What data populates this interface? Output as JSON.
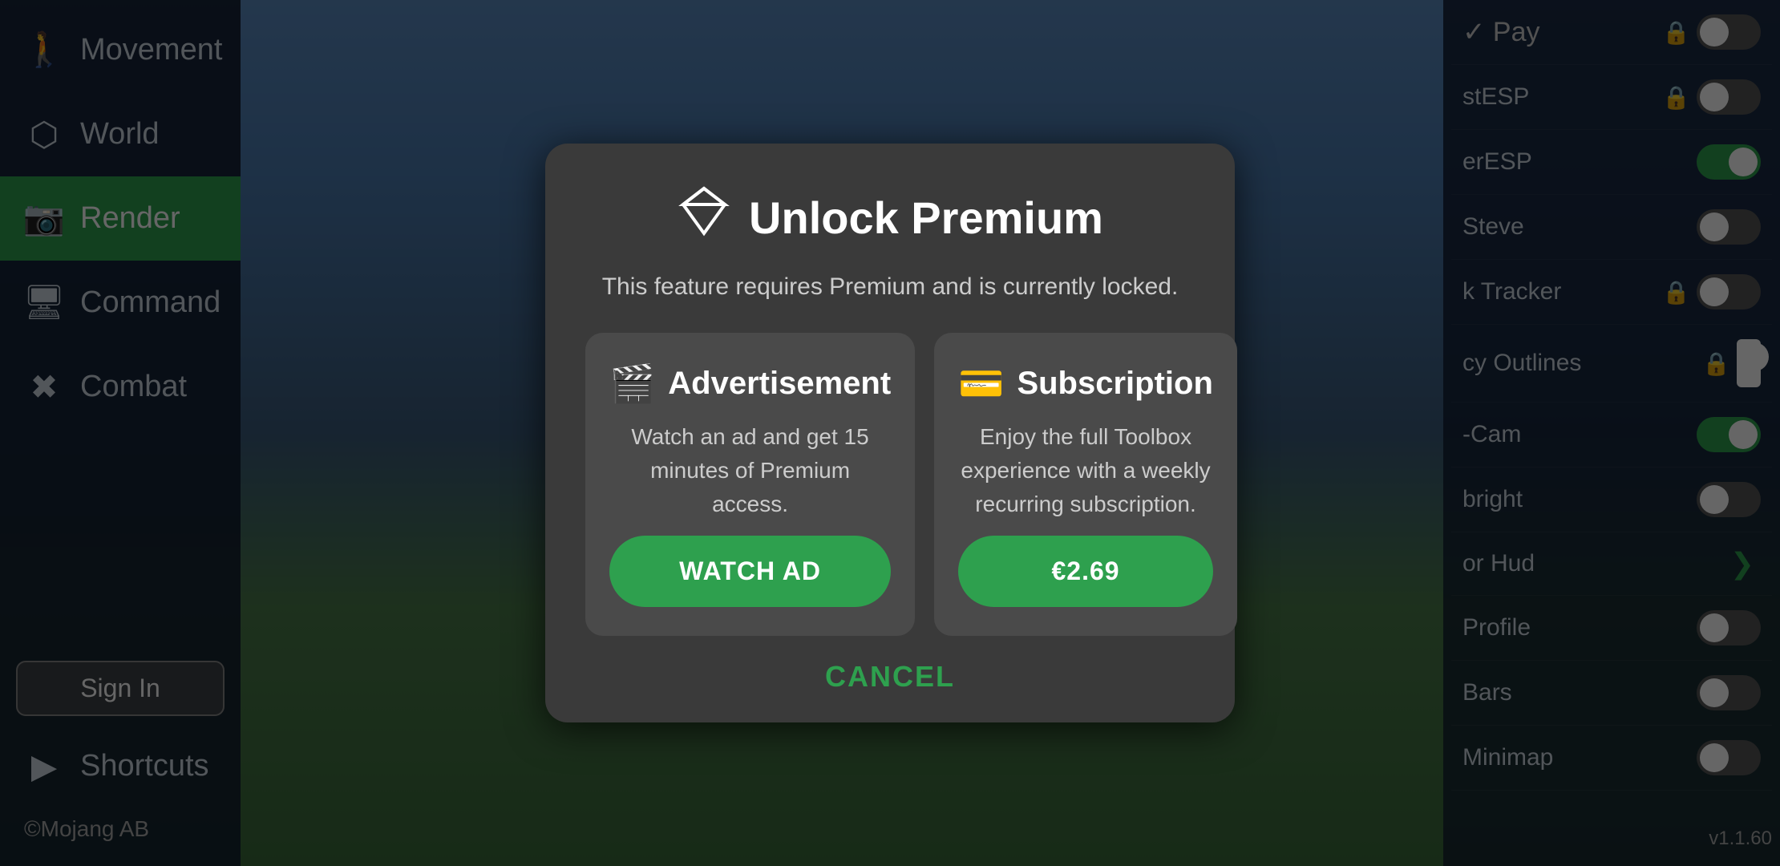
{
  "sidebar": {
    "items": [
      {
        "id": "movement",
        "label": "Movement",
        "icon": "🚶",
        "active": false
      },
      {
        "id": "world",
        "label": "World",
        "icon": "⬡",
        "active": false
      },
      {
        "id": "render",
        "label": "Render",
        "icon": "📷",
        "active": true
      },
      {
        "id": "command",
        "label": "Command",
        "icon": "🖥",
        "active": false
      },
      {
        "id": "combat",
        "label": "Combat",
        "icon": "✖",
        "active": false
      },
      {
        "id": "shortcuts",
        "label": "Shortcuts",
        "icon": "▶",
        "active": false
      }
    ],
    "sign_in_label": "Sign In",
    "mojang_label": "©Mojang AB"
  },
  "right_panel": {
    "header_label": "Pay",
    "rows": [
      {
        "id": "stESP",
        "label": "stESP",
        "has_lock": true,
        "toggle": "off"
      },
      {
        "id": "erESP",
        "label": "erESP",
        "has_lock": false,
        "toggle": "on"
      },
      {
        "id": "steve",
        "label": "Steve",
        "has_lock": false,
        "toggle": "off"
      },
      {
        "id": "tracker",
        "label": "k Tracker",
        "has_lock": true,
        "toggle": "off"
      },
      {
        "id": "outlines",
        "label": "cy Outlines",
        "has_lock": true,
        "toggle": "off"
      },
      {
        "id": "cam",
        "label": "-Cam",
        "has_lock": false,
        "toggle": "on"
      },
      {
        "id": "bright",
        "label": "bright",
        "has_lock": false,
        "toggle": "off"
      },
      {
        "id": "hud",
        "label": "or Hud",
        "has_lock": false,
        "toggle": "chevron"
      },
      {
        "id": "profile",
        "label": "Profile",
        "has_lock": false,
        "toggle": "off"
      },
      {
        "id": "bars",
        "label": "Bars",
        "has_lock": false,
        "toggle": "off"
      },
      {
        "id": "minimap",
        "label": "Minimap",
        "has_lock": false,
        "toggle": "off"
      }
    ],
    "version": "v1.1.60"
  },
  "modal": {
    "title": "Unlock Premium",
    "subtitle": "This feature requires Premium and is currently locked.",
    "advertisement": {
      "title": "Advertisement",
      "description": "Watch an ad and get 15 minutes of Premium access.",
      "button_label": "WATCH AD"
    },
    "subscription": {
      "title": "Subscription",
      "description": "Enjoy the full Toolbox experience with a weekly recurring subscription.",
      "button_label": "€2.69"
    },
    "cancel_label": "CANCEL"
  }
}
